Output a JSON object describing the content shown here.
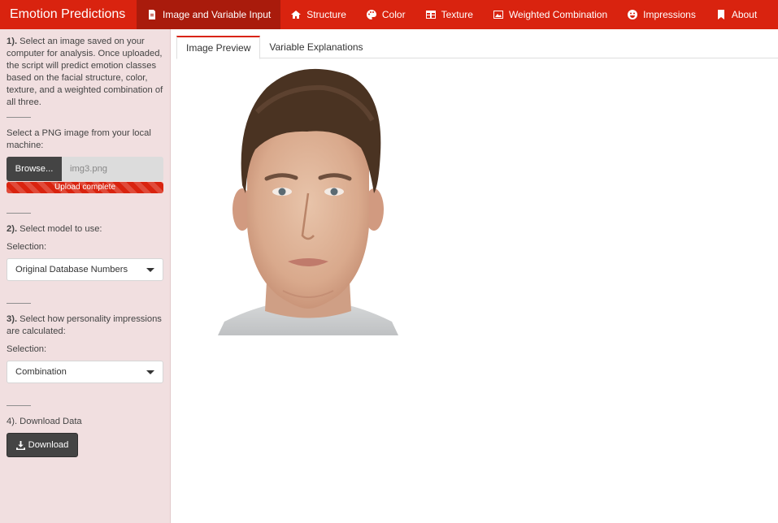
{
  "app": {
    "title": "Emotion Predictions"
  },
  "nav": {
    "items": [
      {
        "label": "Image and Variable Input",
        "icon": "file-icon",
        "active": true
      },
      {
        "label": "Structure",
        "icon": "home-icon"
      },
      {
        "label": "Color",
        "icon": "palette-icon"
      },
      {
        "label": "Texture",
        "icon": "table-icon"
      },
      {
        "label": "Weighted Combination",
        "icon": "image-icon"
      },
      {
        "label": "Impressions",
        "icon": "smile-icon"
      },
      {
        "label": "About",
        "icon": "bookmark-icon"
      }
    ]
  },
  "sidebar": {
    "step1": {
      "num": "1).",
      "text": " Select an image saved on your computer for analysis. Once uploaded, the script will predict emotion classes based on the facial structure, color, texture, and a weighted combination of all three."
    },
    "file": {
      "label": "Select a PNG image from your local machine:",
      "browse_label": "Browse...",
      "filename": "img3.png",
      "progress_text": "Upload complete",
      "progress": 1.0
    },
    "step2": {
      "num": "2).",
      "text": " Select model to use:",
      "selection_label": "Selection:",
      "selected": "Original Database Numbers"
    },
    "step3": {
      "num": "3).",
      "text": " Select how personality impressions are calculated:",
      "selection_label": "Selection:",
      "selected": "Combination"
    },
    "step4": {
      "text": "4). Download Data",
      "download_label": "Download"
    }
  },
  "main": {
    "tabs": [
      {
        "label": "Image Preview",
        "active": true
      },
      {
        "label": "Variable Explanations"
      }
    ]
  },
  "colors": {
    "accent": "#d9230f",
    "sidebar_bg": "#f1dfe0",
    "button_dark": "#444444"
  }
}
